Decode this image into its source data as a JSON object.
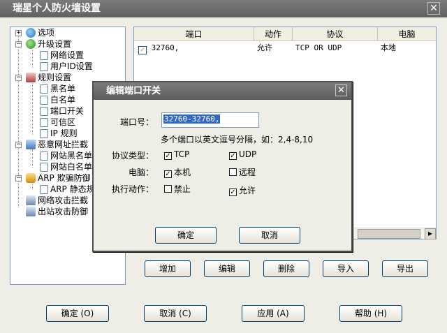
{
  "window": {
    "title": "瑞星个人防火墙设置",
    "close_glyph": "✕"
  },
  "tree": {
    "items": [
      {
        "label": "选项",
        "icon": "options-icon"
      },
      {
        "label": "升级设置",
        "icon": "upgrade-icon"
      },
      {
        "label": "网络设置",
        "icon": "doc-icon"
      },
      {
        "label": "用户ID设置",
        "icon": "doc-icon"
      },
      {
        "label": "规则设置",
        "icon": "rules-icon"
      },
      {
        "label": "黑名单",
        "icon": "doc-icon"
      },
      {
        "label": "白名单",
        "icon": "doc-icon"
      },
      {
        "label": "端口开关",
        "icon": "doc-icon"
      },
      {
        "label": "可信区",
        "icon": "doc-icon"
      },
      {
        "label": "IP 规则",
        "icon": "doc-icon"
      },
      {
        "label": "恶意网址拦截",
        "icon": "url-block-icon"
      },
      {
        "label": "网站黑名单",
        "icon": "doc-icon"
      },
      {
        "label": "网站白名单",
        "icon": "doc-icon"
      },
      {
        "label": "ARP 欺骗防御",
        "icon": "arp-icon"
      },
      {
        "label": "ARP 静态规则",
        "icon": "doc-icon"
      },
      {
        "label": "网络攻击拦截",
        "icon": "network-attack-icon"
      },
      {
        "label": "出站攻击防御",
        "icon": "outbound-attack-icon"
      }
    ]
  },
  "table": {
    "columns": [
      "端口",
      "动作",
      "协议",
      "电脑"
    ],
    "rows": [
      {
        "port": "32760,",
        "action": "允许",
        "protocol": "TCP OR UDP",
        "computer": "本地",
        "checked": true
      }
    ]
  },
  "list_buttons": {
    "add": "增加",
    "edit": "编辑",
    "delete": "删除",
    "import": "导入",
    "export": "导出"
  },
  "footer_buttons": {
    "ok": "确定 (O)",
    "cancel": "取消 (C)",
    "apply": "应用 (A)",
    "help": "帮助 (H)"
  },
  "dialog": {
    "title": "编辑端口开关",
    "port_label": "端口号：",
    "port_value": "32760-32760,",
    "hint": "多个端口以英文逗号分隔，如：2,4-8,10",
    "protocol_label": "协议类型：",
    "tcp_label": "TCP",
    "udp_label": "UDP",
    "computer_label": "电脑：",
    "local_label": "本机",
    "remote_label": "远程",
    "action_label": "执行动作：",
    "deny_label": "禁止",
    "allow_label": "允许",
    "ok": "确定",
    "cancel": "取消",
    "check_glyph": "✓",
    "state": {
      "tcp": true,
      "udp": true,
      "local": true,
      "remote": false,
      "deny": false,
      "allow": true
    }
  }
}
